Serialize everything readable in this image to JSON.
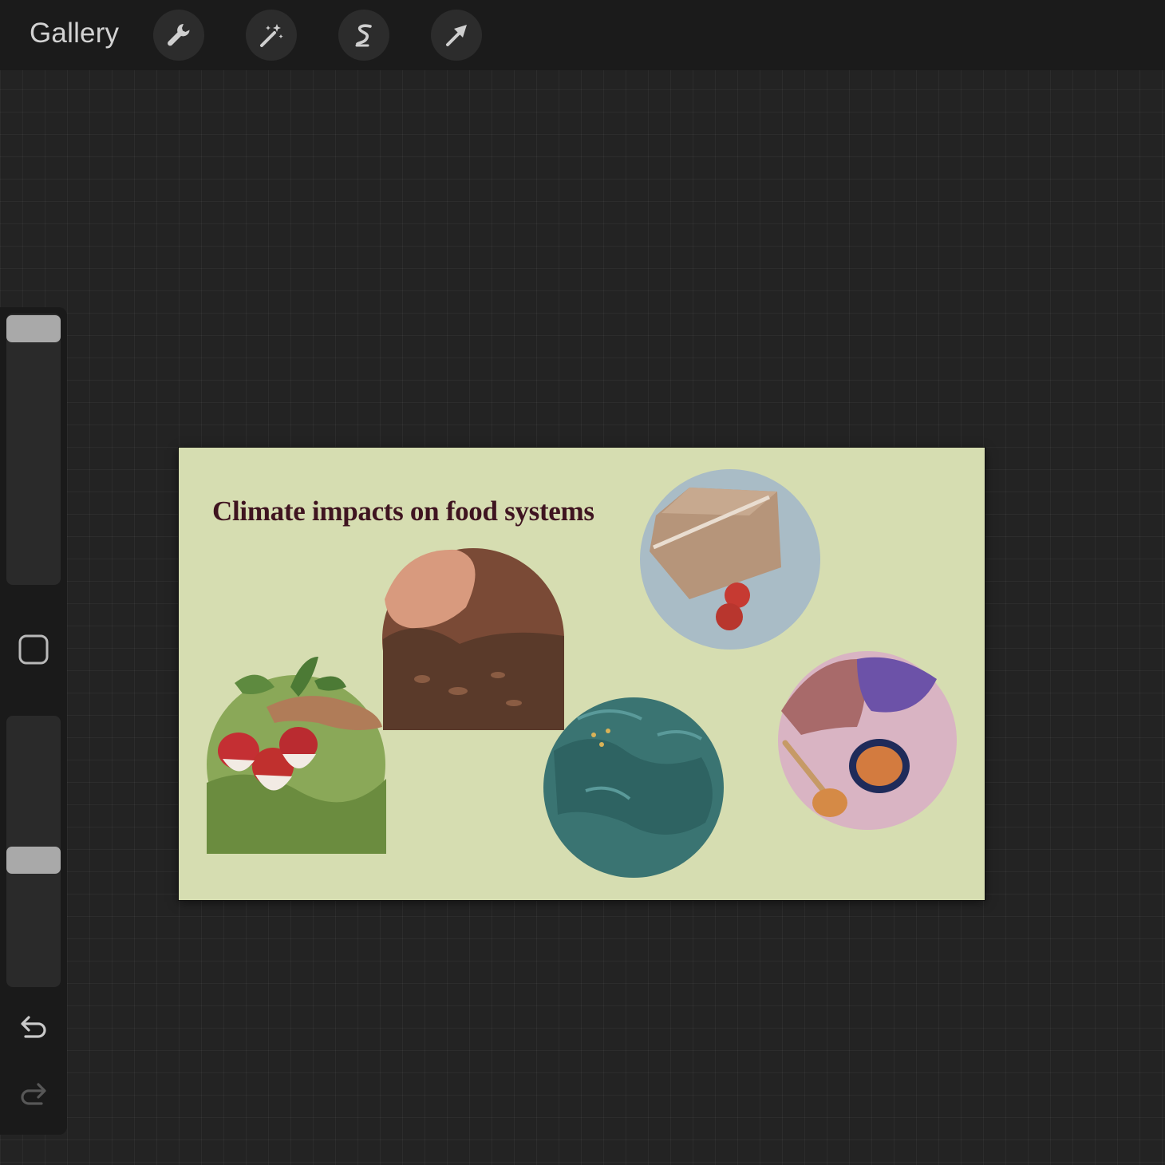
{
  "app": {
    "gallery_label": "Gallery",
    "toolbar_icons": [
      "wrench-icon",
      "magic-wand-icon",
      "selection-s-icon",
      "move-arrow-icon"
    ]
  },
  "sidebar": {
    "size_slider_level": 0.0,
    "opacity_slider_level": 0.5,
    "icons": [
      "modify-square-icon",
      "undo-icon",
      "redo-icon"
    ]
  },
  "canvas": {
    "title": "Climate impacts on food systems",
    "background_color": "#d6ddb1",
    "illustrations": [
      "radish-harvest",
      "soil-and-seed",
      "delivery-box-strawberries",
      "ocean-water",
      "soup-pot-kitchen"
    ]
  },
  "colors": {
    "app_background": "#232323",
    "topbar": "#1b1b1b",
    "title_text": "#3f1420",
    "slider_thumb": "#a9a9a9"
  }
}
